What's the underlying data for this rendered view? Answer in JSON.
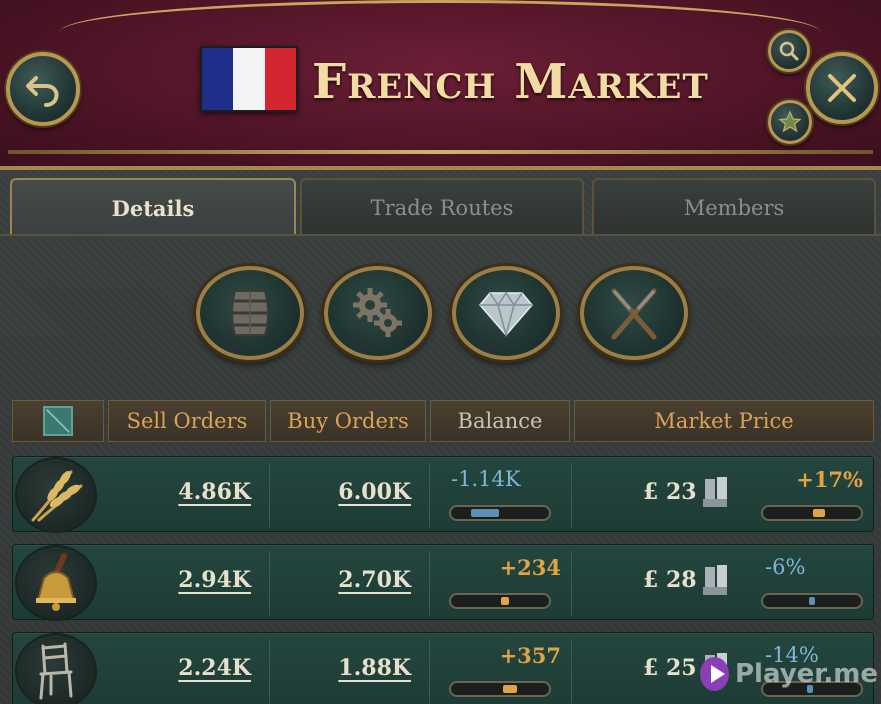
{
  "header": {
    "title": "French Market",
    "flag_colors": [
      "#1f2f8a",
      "#f4f4f4",
      "#d42630"
    ]
  },
  "controls": {
    "back_icon": "undo-arrow-icon",
    "search_icon": "magnifier-icon",
    "close_icon": "close-x-icon",
    "favorite_icon": "star-icon"
  },
  "tabs": [
    {
      "label": "Details",
      "active": true
    },
    {
      "label": "Trade Routes",
      "active": false
    },
    {
      "label": "Members",
      "active": false
    }
  ],
  "categories": [
    {
      "icon": "barrel-icon"
    },
    {
      "icon": "gears-icon"
    },
    {
      "icon": "diamond-icon"
    },
    {
      "icon": "crossed-rifles-icon"
    }
  ],
  "columns": {
    "toggle_icon": "expand-toggle-icon",
    "sell": "Sell Orders",
    "buy": "Buy Orders",
    "balance": "Balance",
    "price": "Market Price"
  },
  "goods": [
    {
      "icon": "grain-icon",
      "sell": "4.86K",
      "buy": "6.00K",
      "balance": "-1.14K",
      "balance_trend": "negative",
      "balance_level": 0.35,
      "price": "£ 23",
      "price_change": "+17%",
      "price_trend": "positive",
      "price_level": 0.58
    },
    {
      "icon": "bell-icon",
      "sell": "2.94K",
      "buy": "2.70K",
      "balance": "+234",
      "balance_trend": "positive",
      "balance_level": 0.55,
      "price": "£ 28",
      "price_change": "-6%",
      "price_trend": "negative",
      "price_level": 0.48
    },
    {
      "icon": "chair-icon",
      "sell": "2.24K",
      "buy": "1.88K",
      "balance": "+357",
      "balance_trend": "positive",
      "balance_level": 0.6,
      "price": "£ 25",
      "price_change": "-14%",
      "price_trend": "negative",
      "price_level": 0.45
    }
  ],
  "watermark": {
    "text": "Player.me"
  }
}
